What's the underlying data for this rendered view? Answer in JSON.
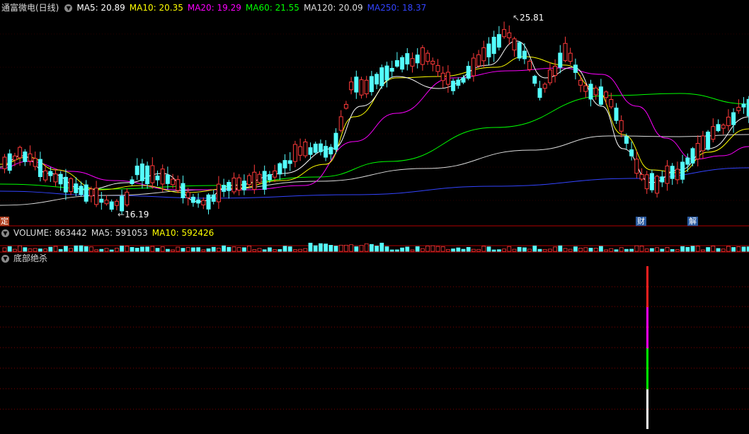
{
  "stock_title": "通富微电(日线)",
  "ma": [
    {
      "label": "MA5: 20.89",
      "color": "#ffffff"
    },
    {
      "label": "MA10: 20.35",
      "color": "#ffff00"
    },
    {
      "label": "MA20: 19.29",
      "color": "#ff00ff"
    },
    {
      "label": "MA60: 21.55",
      "color": "#00ff00"
    },
    {
      "label": "MA120: 20.09",
      "color": "#dddddd"
    },
    {
      "label": "MA250: 18.37",
      "color": "#3344ff"
    }
  ],
  "price_high_label": "25.81",
  "price_low_label": "16.19",
  "markers": {
    "left": "定",
    "cai": "财",
    "jie": "解"
  },
  "volume_header": [
    {
      "label": "VOLUME: 863442",
      "color": "#dddddd"
    },
    {
      "label": "MA5: 591053",
      "color": "#dddddd"
    },
    {
      "label": "MA10: 592426",
      "color": "#ffff00"
    }
  ],
  "indicator_title": "底部绝杀",
  "icons": {
    "panel_toggle": "chevron-down-icon"
  },
  "colors": {
    "up": "#ff3a3a",
    "down": "#54ffff",
    "grid": "#800000",
    "border": "#b00000"
  }
}
